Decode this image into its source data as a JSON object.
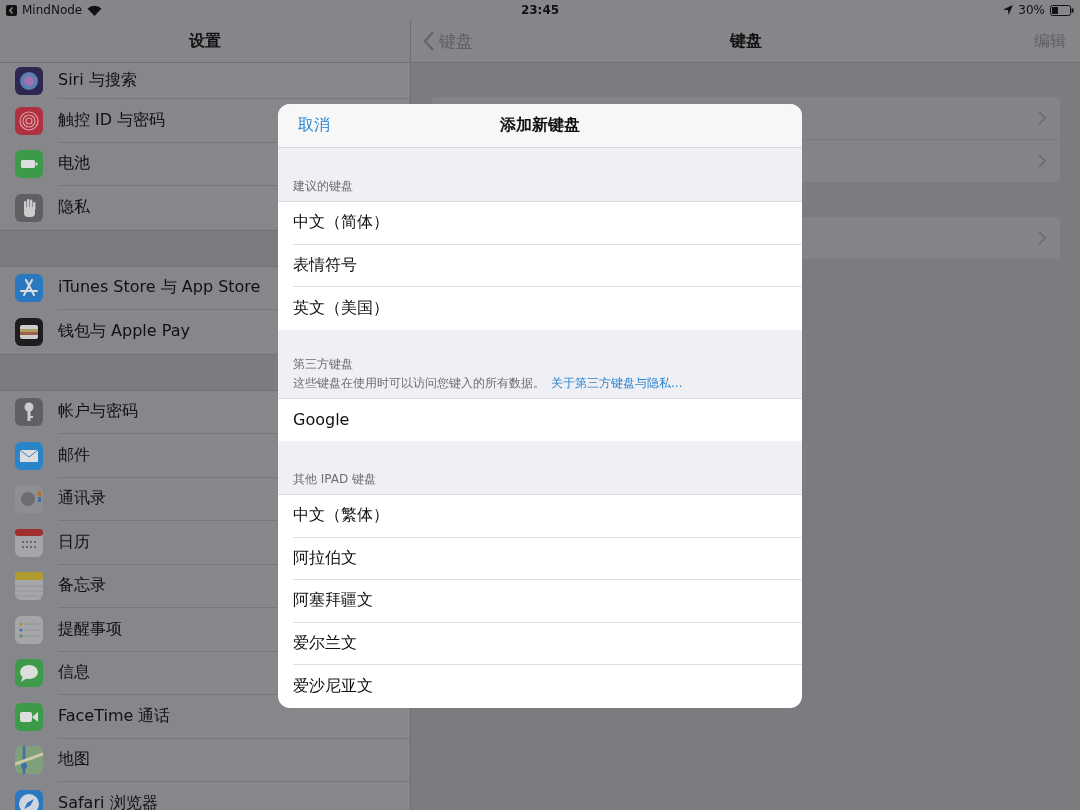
{
  "status_bar": {
    "back_app": "MindNode",
    "time": "23:45",
    "battery": "30%"
  },
  "sidebar": {
    "title": "设置",
    "groups": [
      {
        "items": [
          {
            "label": "Siri 与搜索"
          },
          {
            "label": "触控 ID 与密码"
          },
          {
            "label": "电池"
          },
          {
            "label": "隐私"
          }
        ]
      },
      {
        "items": [
          {
            "label": "iTunes Store 与 App Store"
          },
          {
            "label": "钱包与 Apple Pay"
          }
        ]
      },
      {
        "items": [
          {
            "label": "帐户与密码"
          },
          {
            "label": "邮件"
          },
          {
            "label": "通讯录"
          },
          {
            "label": "日历"
          },
          {
            "label": "备忘录"
          },
          {
            "label": "提醒事项"
          },
          {
            "label": "信息"
          },
          {
            "label": "FaceTime 通话"
          },
          {
            "label": "地图"
          },
          {
            "label": "Safari 浏览器"
          }
        ]
      }
    ]
  },
  "detail": {
    "back": "键盘",
    "title": "键盘",
    "edit": "编辑"
  },
  "dialog": {
    "cancel": "取消",
    "title": "添加新键盘",
    "sections": [
      {
        "header": "建议的键盘",
        "items": [
          "中文（简体）",
          "表情符号",
          "英文（美国）"
        ]
      },
      {
        "header": "第三方键盘",
        "note": "这些键盘在使用时可以访问您键入的所有数据。",
        "note_link": "关于第三方键盘与隐私...",
        "items": [
          "Google"
        ]
      },
      {
        "header": "其他 IPAD 键盘",
        "items": [
          "中文（繁体）",
          "阿拉伯文",
          "阿塞拜疆文",
          "爱尔兰文",
          "爱沙尼亚文"
        ]
      }
    ]
  }
}
